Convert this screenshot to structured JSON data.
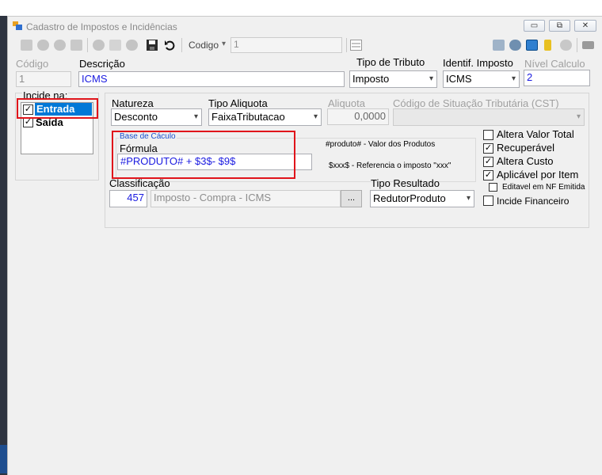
{
  "window": {
    "title": "Cadastro de Impostos e Incidências"
  },
  "window_controls": {
    "minimize": "▭",
    "maximize": "⧉",
    "close": "✕"
  },
  "toolbar": {
    "codigo_label": "Codigo",
    "codigo_dropdown": "▾",
    "codigo_value": "1"
  },
  "fields": {
    "codigo_label": "Código",
    "codigo_value": "1",
    "descricao_label": "Descrição",
    "descricao_value": "ICMS",
    "tipo_tributo_label": "Tipo de Tributo",
    "tipo_tributo_value": "Imposto",
    "identif_imposto_label": "Identif. Imposto",
    "identif_imposto_value": "ICMS",
    "nivel_calculo_label": "Nível Calculo",
    "nivel_calculo_value": "2"
  },
  "incide": {
    "label": "Incide na:",
    "items": [
      {
        "label": "Entrada",
        "checked": true
      },
      {
        "label": "Saída",
        "checked": true
      }
    ]
  },
  "natureza": {
    "label": "Natureza",
    "value": "Desconto"
  },
  "tipo_aliquota": {
    "label": "Tipo Aliquota",
    "value": "FaixaTributacao"
  },
  "aliquota": {
    "label": "Aliquota",
    "value": "0,0000"
  },
  "cst": {
    "label": "Código de Situação Tributária (CST)",
    "value": ""
  },
  "base_calculo": {
    "legend": "Base de Cáculo",
    "formula_label": "Fórmula",
    "formula_value": "#PRODUTO# + $3$- $9$",
    "help1": "#produto# - Valor dos Produtos",
    "help2": "$xxx$ - Referencia o imposto \"xxx\""
  },
  "options": [
    {
      "label": "Altera Valor Total",
      "checked": false
    },
    {
      "label": "Recuperável",
      "checked": true
    },
    {
      "label": "Altera Custo",
      "checked": true
    },
    {
      "label": "Aplicável por Item",
      "checked": true
    },
    {
      "label": "Editavel em NF Emitida",
      "checked": false
    },
    {
      "label": "Incide Financeiro",
      "checked": false
    }
  ],
  "classificacao": {
    "label": "Classificação",
    "code": "457",
    "description": "Imposto - Compra - ICMS",
    "button": "..."
  },
  "tipo_resultado": {
    "label": "Tipo Resultado",
    "value": "RedutorProduto"
  },
  "colors": {
    "accent_red": "#e0141b",
    "text_blue": "#1a1ae0",
    "selection_blue": "#0078d7"
  }
}
